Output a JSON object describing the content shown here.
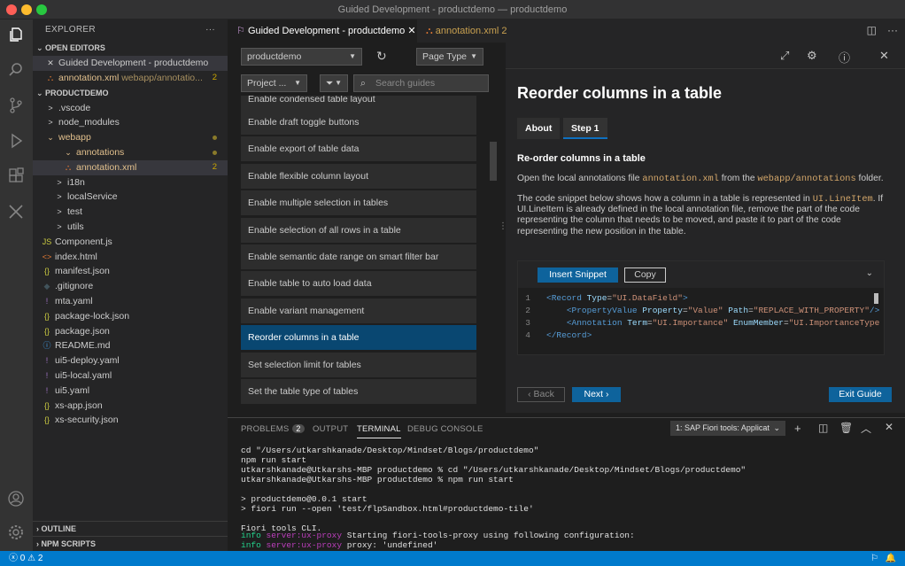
{
  "window": {
    "title": "Guided Development - productdemo — productdemo"
  },
  "explorer": {
    "header": "EXPLORER",
    "more": "···",
    "open_editors_label": "OPEN EDITORS",
    "open_editors": [
      {
        "name": "Guided Development - productdemo",
        "close": "✕"
      },
      {
        "name": "annotation.xml",
        "path": "webapp/annotatio...",
        "badge": "2"
      }
    ],
    "project_label": "PRODUCTDEMO",
    "tree": [
      {
        "name": ".vscode",
        "icon": ">"
      },
      {
        "name": "node_modules",
        "icon": ">"
      },
      {
        "name": "webapp",
        "icon": "⌄"
      },
      {
        "name": "annotations",
        "icon": "⌄"
      },
      {
        "name": "annotation.xml",
        "icon": "⛬",
        "badge": "2"
      },
      {
        "name": "i18n",
        "icon": ">"
      },
      {
        "name": "localService",
        "icon": ">"
      },
      {
        "name": "test",
        "icon": ">"
      },
      {
        "name": "utils",
        "icon": ">"
      },
      {
        "name": "Component.js",
        "icon": "JS"
      },
      {
        "name": "index.html",
        "icon": "<>"
      },
      {
        "name": "manifest.json",
        "icon": "{}"
      },
      {
        "name": ".gitignore",
        "icon": "◆"
      },
      {
        "name": "mta.yaml",
        "icon": "!"
      },
      {
        "name": "package-lock.json",
        "icon": "{}"
      },
      {
        "name": "package.json",
        "icon": "{}"
      },
      {
        "name": "README.md",
        "icon": "ⓘ"
      },
      {
        "name": "ui5-deploy.yaml",
        "icon": "!"
      },
      {
        "name": "ui5-local.yaml",
        "icon": "!"
      },
      {
        "name": "ui5.yaml",
        "icon": "!"
      },
      {
        "name": "xs-app.json",
        "icon": "{}"
      },
      {
        "name": "xs-security.json",
        "icon": "{}"
      }
    ],
    "outline": "OUTLINE",
    "npm": "NPM SCRIPTS"
  },
  "tabs": [
    {
      "label": "Guided Development - productdemo",
      "close": "✕"
    },
    {
      "label": "annotation.xml",
      "badge": "2"
    }
  ],
  "guides": {
    "project_select": "productdemo",
    "page_type": "Page Type",
    "project_filter": "Project ...",
    "search_placeholder": "Search guides",
    "partial_item": "Enable condensed table layout",
    "items": [
      "Enable draft toggle buttons",
      "Enable export of table data",
      "Enable flexible column layout",
      "Enable multiple selection in tables",
      "Enable selection of all rows in a table",
      "Enable semantic date range on smart filter bar",
      "Enable table to auto load data",
      "Enable variant management",
      "Reorder columns in a table",
      "Set selection limit for tables",
      "Set the table type of tables"
    ],
    "selected_index": 8
  },
  "detail": {
    "title": "Reorder columns in a table",
    "tab_about": "About",
    "tab_step": "Step 1",
    "step_title": "Re-order columns in a table",
    "p1_a": "Open the local annotations file ",
    "p1_code1": "annotation.xml",
    "p1_b": " from the ",
    "p1_code2": "webapp/annotations",
    "p1_c": " folder.",
    "p2_a": "The code snippet below shows how a column in a table is represented in ",
    "p2_code": "UI.LineItem",
    "p2_b": ". If UI.LineItem is already defined in the local annotation file, remove the part of the code representing the column that needs to be moved, and paste it to part of the code representing the new position in the table.",
    "insert": "Insert Snippet",
    "copy": "Copy",
    "back": "‹ Back",
    "next": "Next ›",
    "exit": "Exit Guide"
  },
  "panel": {
    "problems": "PROBLEMS",
    "problems_count": "2",
    "output": "OUTPUT",
    "terminal": "TERMINAL",
    "debug": "DEBUG CONSOLE",
    "terminal_select": "1: SAP Fiori tools: Applicat",
    "lines": [
      "cd \"/Users/utkarshkanade/Desktop/Mindset/Blogs/productdemo\"",
      "npm run start",
      "utkarshkanade@Utkarshs-MBP productdemo % cd \"/Users/utkarshkanade/Desktop/Mindset/Blogs/productdemo\"",
      "utkarshkanade@Utkarshs-MBP productdemo % npm run start",
      "",
      "> productdemo@0.0.1 start",
      "> fiori run --open 'test/flpSandbox.html#productdemo-tile'",
      "",
      "Fiori tools CLI."
    ],
    "info1_a": "info ",
    "info1_b": "server:ux-proxy",
    "info1_c": " Starting fiori-tools-proxy using following configuration:",
    "info2_a": "info ",
    "info2_b": "server:ux-proxy",
    "info2_c": " proxy: 'undefined'"
  },
  "status": {
    "errors": "0",
    "warnings": "2"
  }
}
